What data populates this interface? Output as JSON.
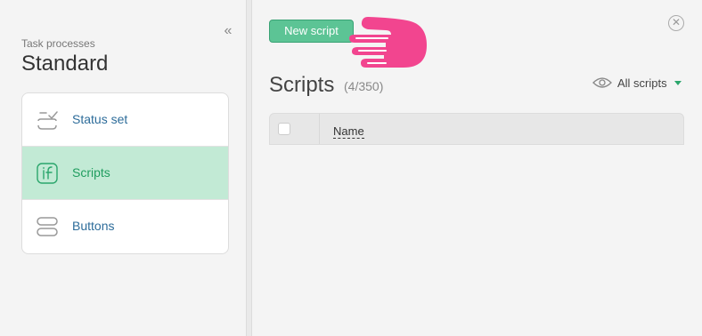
{
  "sidebar": {
    "subtitle": "Task processes",
    "title": "Standard",
    "collapse_glyph": "«",
    "items": [
      {
        "label": "Status set",
        "icon": "status-set-icon",
        "active": false
      },
      {
        "label": "Scripts",
        "icon": "script-icon",
        "active": true
      },
      {
        "label": "Buttons",
        "icon": "buttons-icon",
        "active": false
      }
    ]
  },
  "main": {
    "new_button": "New script",
    "close_glyph": "✕",
    "title": "Scripts",
    "count": "(4/350)",
    "filter_label": "All scripts",
    "table": {
      "columns": [
        "Name"
      ]
    }
  },
  "colors": {
    "accent": "#5cc495",
    "active_bg": "#c2ead5",
    "active_text": "#1f9d5f",
    "link": "#2d6c9a",
    "pointer": "#f2458f"
  }
}
